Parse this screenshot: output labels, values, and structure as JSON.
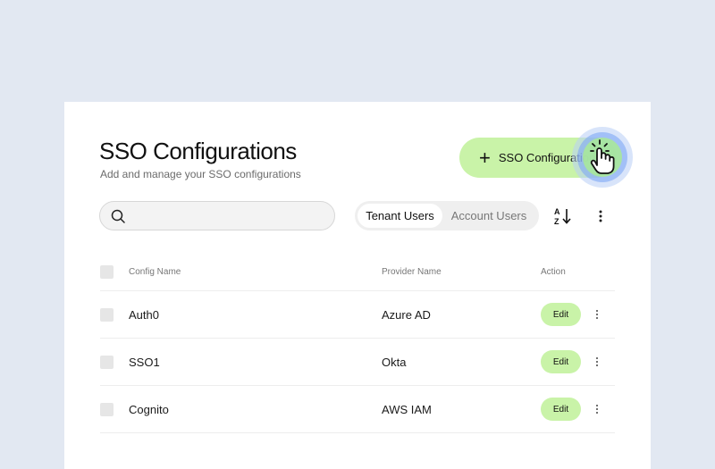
{
  "header": {
    "title": "SSO Configurations",
    "subtitle": "Add and manage your SSO configurations",
    "add_button_label": "SSO Configuration"
  },
  "search": {
    "value": "",
    "placeholder": ""
  },
  "toggle": {
    "tabs": [
      "Tenant Users",
      "Account Users"
    ],
    "active": "Tenant Users"
  },
  "table": {
    "columns": [
      "Config Name",
      "Provider Name",
      "Action"
    ],
    "rows": [
      {
        "config_name": "Auth0",
        "provider": "Azure AD",
        "action": "Edit"
      },
      {
        "config_name": "SSO1",
        "provider": "Okta",
        "action": "Edit"
      },
      {
        "config_name": "Cognito",
        "provider": "AWS IAM",
        "action": "Edit"
      }
    ]
  },
  "icons": [
    "search-icon",
    "plus-icon",
    "sort-az-icon",
    "more-vertical-icon",
    "pointer-hand-icon"
  ],
  "colors": {
    "background": "#e2e8f2",
    "accent": "#c9f3a8",
    "cursor_halo": "#7fa8f5"
  }
}
